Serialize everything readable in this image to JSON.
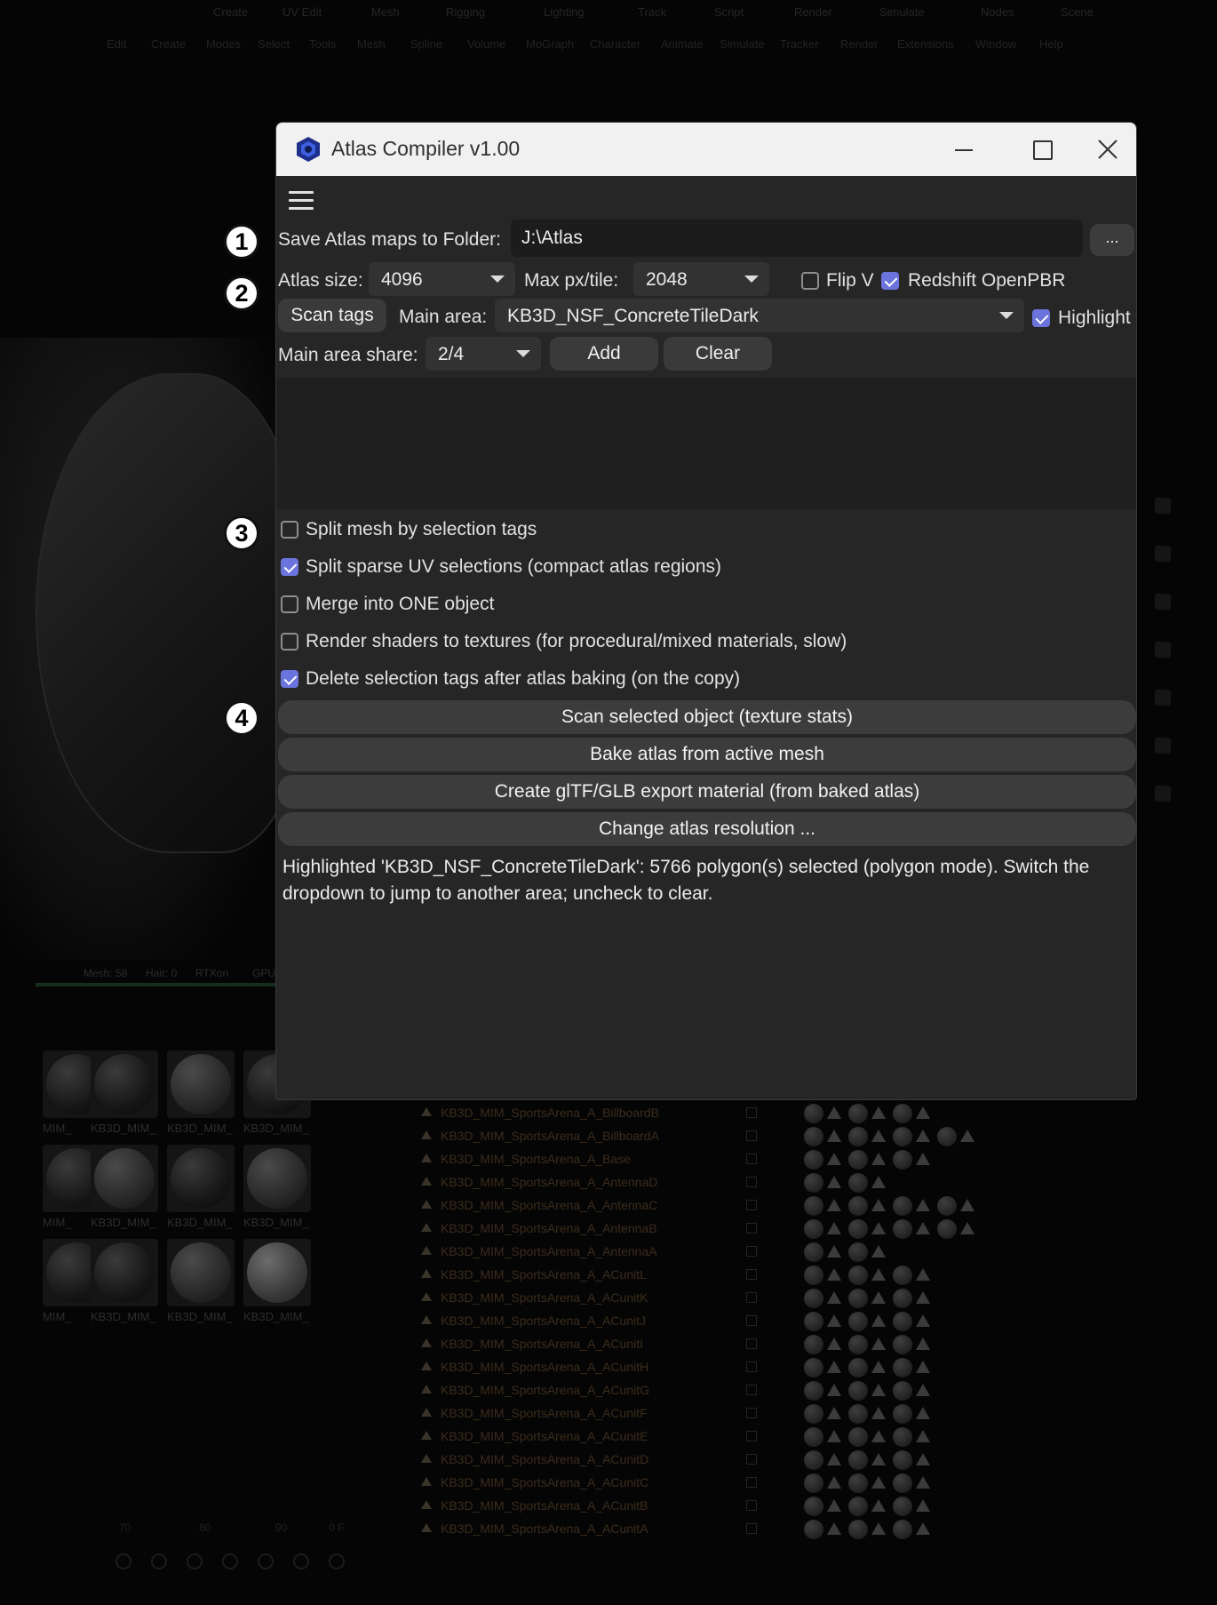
{
  "background": {
    "menubar": [
      "Create",
      "UV Edit",
      "Mesh",
      "Rigging",
      "Lighting",
      "Track",
      "Script",
      "Render",
      "Simulate",
      "Nodes",
      "Scene"
    ],
    "menubar2": [
      "Edit",
      "Create",
      "Modes",
      "Select",
      "Tools",
      "Mesh",
      "Spline",
      "Volume",
      "MoGraph",
      "Character",
      "Animate",
      "Simulate",
      "Tracker",
      "Render",
      "Extensions",
      "Window",
      "Help"
    ],
    "status": {
      "mesh": "Mesh: 58",
      "hair": "Hair: 0",
      "rtx": "RTXon",
      "gpu": "GPU"
    },
    "material_label": "KB3D_MIM_",
    "material_label_short": "MIM_",
    "objects": [
      "KB3D_MIM_SportsArena_A_BillboardB",
      "KB3D_MIM_SportsArena_A_BillboardA",
      "KB3D_MIM_SportsArena_A_Base",
      "KB3D_MIM_SportsArena_A_AntennaD",
      "KB3D_MIM_SportsArena_A_AntennaC",
      "KB3D_MIM_SportsArena_A_AntennaB",
      "KB3D_MIM_SportsArena_A_AntennaA",
      "KB3D_MIM_SportsArena_A_ACunitL",
      "KB3D_MIM_SportsArena_A_ACunitK",
      "KB3D_MIM_SportsArena_A_ACunitJ",
      "KB3D_MIM_SportsArena_A_ACunitI",
      "KB3D_MIM_SportsArena_A_ACunitH",
      "KB3D_MIM_SportsArena_A_ACunitG",
      "KB3D_MIM_SportsArena_A_ACunitF",
      "KB3D_MIM_SportsArena_A_ACunitE",
      "KB3D_MIM_SportsArena_A_ACunitD",
      "KB3D_MIM_SportsArena_A_ACunitC",
      "KB3D_MIM_SportsArena_A_ACunitB",
      "KB3D_MIM_SportsArena_A_ACunitA"
    ],
    "timeline": [
      "70",
      "80",
      "90",
      "0 F"
    ]
  },
  "dialog": {
    "title": "Atlas Compiler v1.00",
    "folder": {
      "label": "Save Atlas maps to Folder:",
      "value": "J:\\Atlas",
      "browse_label": "..."
    },
    "atlas_size": {
      "label": "Atlas size:",
      "value": "4096"
    },
    "max_px": {
      "label": "Max px/tile:",
      "value": "2048"
    },
    "flip_v": {
      "label": "Flip V",
      "checked": false
    },
    "redshift": {
      "label": "Redshift OpenPBR",
      "checked": true
    },
    "scan_tags_label": "Scan tags",
    "main_area": {
      "label": "Main area:",
      "value": "KB3D_NSF_ConcreteTileDark"
    },
    "highlight": {
      "label": "Highlight",
      "checked": true
    },
    "main_area_share": {
      "label": "Main area share:",
      "value": "2/4"
    },
    "add_label": "Add",
    "clear_label": "Clear",
    "options": [
      {
        "label": "Split mesh by selection tags",
        "checked": false
      },
      {
        "label": "Split sparse UV selections (compact atlas regions)",
        "checked": true
      },
      {
        "label": "Merge into ONE object",
        "checked": false
      },
      {
        "label": "Render shaders to textures (for procedural/mixed materials, slow)",
        "checked": false
      },
      {
        "label": "Delete selection tags after atlas baking (on the copy)",
        "checked": true
      }
    ],
    "actions": [
      "Scan selected object (texture stats)",
      "Bake atlas from active mesh",
      "Create glTF/GLB export material (from baked atlas)",
      "Change atlas resolution ..."
    ],
    "log": "Highlighted 'KB3D_NSF_ConcreteTileDark': 5766 polygon(s) selected (polygon mode). Switch the dropdown to jump to another area; uncheck to clear."
  },
  "markers": [
    "1",
    "2",
    "3",
    "4"
  ],
  "colors": {
    "accent": "#6b74dc",
    "dialog_bg": "#262626",
    "titlebar": "#f1f1f1"
  }
}
